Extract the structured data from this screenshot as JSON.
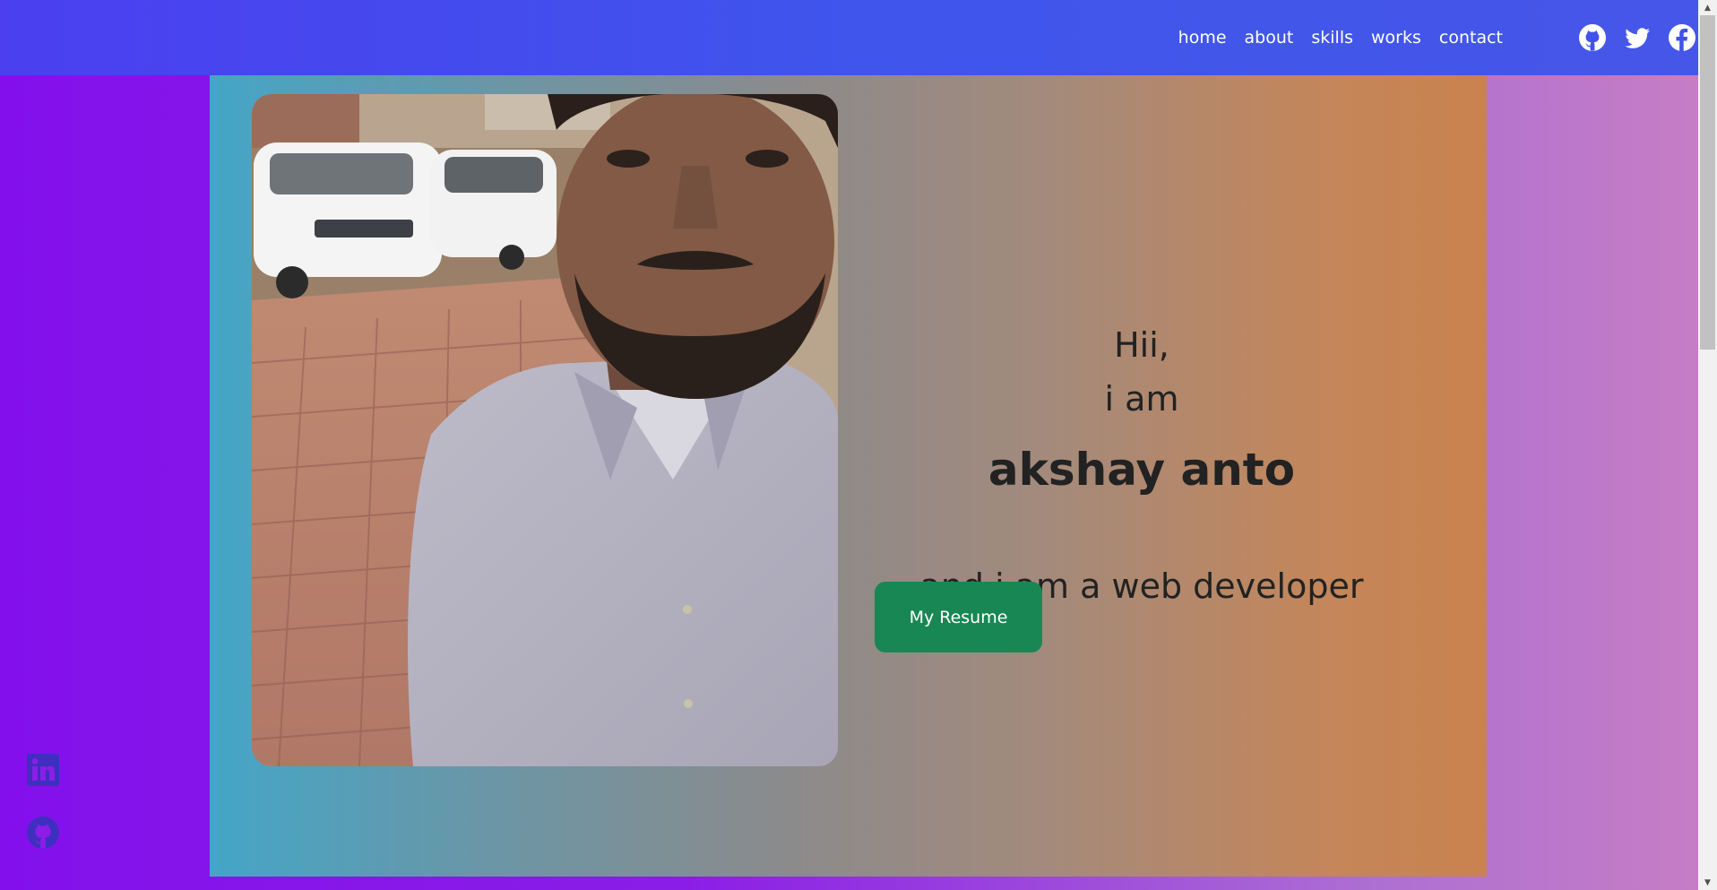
{
  "nav": {
    "links": [
      "home",
      "about",
      "skills",
      "works",
      "contact"
    ],
    "social_icons": [
      "github-icon",
      "twitter-icon",
      "facebook-icon"
    ]
  },
  "hero": {
    "greeting": "Hii,",
    "intro": "i am",
    "name": "akshay anto",
    "role": "and i am a web developer",
    "resume_button": "My Resume",
    "photo": "portrait-photo"
  },
  "side_social": [
    "linkedin-icon",
    "github-icon"
  ],
  "colors": {
    "nav_bg": "#4150ec",
    "button_bg": "#198754",
    "page_bg_left": "#8310ec",
    "page_bg_right": "#c77ec4",
    "hero_left": "#44a6c7",
    "hero_right": "#c9824f",
    "side_icon": "#3d2fbf"
  }
}
